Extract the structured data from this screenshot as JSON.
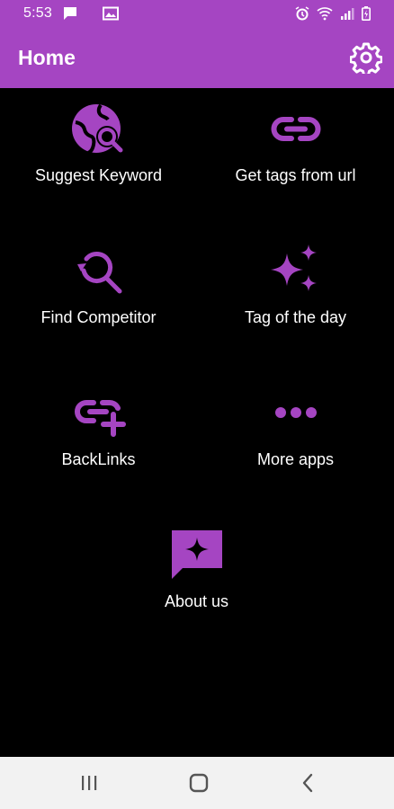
{
  "status_bar": {
    "time": "5:53",
    "left_icons": [
      "message-icon",
      "image-icon"
    ],
    "right_icons": [
      "alarm-icon",
      "wifi-icon",
      "signal-icon",
      "battery-icon"
    ]
  },
  "header": {
    "title": "Home",
    "settings_icon": "gear-icon"
  },
  "menu": {
    "items": [
      {
        "label": "Suggest Keyword",
        "icon": "globe-search-icon"
      },
      {
        "label": "Get tags from url",
        "icon": "link-icon"
      },
      {
        "label": "Find Competitor",
        "icon": "search-refresh-icon"
      },
      {
        "label": "Tag of the day",
        "icon": "sparkles-icon"
      },
      {
        "label": "BackLinks",
        "icon": "add-link-icon"
      },
      {
        "label": "More apps",
        "icon": "more-horizontal-icon"
      },
      {
        "label": "About us",
        "icon": "chat-sparkle-icon"
      }
    ]
  },
  "nav_bar": {
    "buttons": [
      "recent-apps-icon",
      "home-icon",
      "back-icon"
    ]
  },
  "colors": {
    "accent": "#a545c2",
    "background": "#000000",
    "text": "#ffffff",
    "nav_background": "#f2f2f2"
  }
}
